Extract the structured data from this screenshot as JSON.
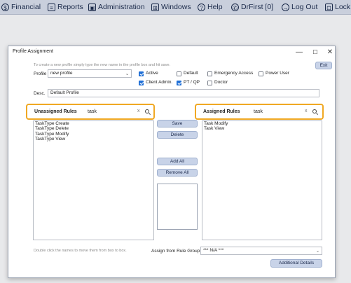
{
  "menubar": {
    "items": [
      {
        "label": "Financial",
        "icon": "dollar-icon"
      },
      {
        "label": "Reports",
        "icon": "reports-icon"
      },
      {
        "label": "Administration",
        "icon": "administration-icon"
      },
      {
        "label": "Windows",
        "icon": "windows-icon"
      },
      {
        "label": "Help",
        "icon": "help-icon"
      },
      {
        "label": "DrFirst [0]",
        "icon": "drfirst-icon"
      },
      {
        "label": "Log Out",
        "icon": "logout-icon"
      },
      {
        "label": "Lock",
        "icon": "lock-icon"
      }
    ]
  },
  "dialog": {
    "title": "Profile Assignment",
    "window_buttons": {
      "minimize": "—",
      "maximize": "☐",
      "close": "✕"
    },
    "exit_label": "Exit",
    "hint": "To create a new profile simply type the new name in the profile box and hit save.",
    "profile_label": "Profile",
    "profile_value": "new profile",
    "desc_label": "Desc.",
    "desc_value": "Default Profile",
    "checkboxes": [
      {
        "label": "Active",
        "checked": true
      },
      {
        "label": "Default",
        "checked": false
      },
      {
        "label": "Emergency Access",
        "checked": false
      },
      {
        "label": "Power User",
        "checked": false
      },
      {
        "label": "Client Admin.",
        "checked": true
      },
      {
        "label": "PT / QP",
        "checked": true
      },
      {
        "label": "Doctor",
        "checked": false
      }
    ],
    "unassigned": {
      "label": "Unassigned Rules",
      "search_value": "task",
      "clear": "x",
      "items": [
        "TaskType Create",
        "TaskType Delete",
        "TaskType Modify",
        "TaskType View"
      ]
    },
    "assigned": {
      "label": "Assigned Rules",
      "search_value": "task",
      "clear": "x",
      "items": [
        "Task Modify",
        "Task View"
      ]
    },
    "buttons": {
      "save": "Save",
      "delete": "Delete",
      "add_all": "Add All",
      "remove_all": "Remove All",
      "additional_details": "Additional Details"
    },
    "footer_hint": "Double click the names to move them from box to box.",
    "rule_group_label": "Assign from Rule Group",
    "rule_group_value": "*** N/A ***"
  },
  "colors": {
    "menubar": "#c9cfdc",
    "button": "#c8d3e8",
    "highlight": "#f0a823",
    "checkbox_on": "#1f6fd6"
  }
}
